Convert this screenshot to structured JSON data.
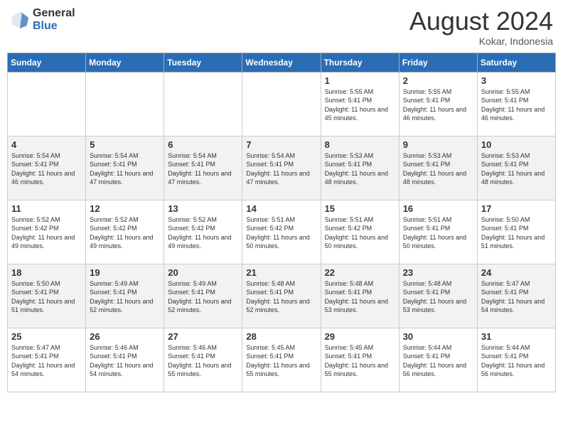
{
  "header": {
    "logo_general": "General",
    "logo_blue": "Blue",
    "month_year": "August 2024",
    "location": "Kokar, Indonesia"
  },
  "days_of_week": [
    "Sunday",
    "Monday",
    "Tuesday",
    "Wednesday",
    "Thursday",
    "Friday",
    "Saturday"
  ],
  "weeks": [
    [
      {
        "day": "",
        "sunrise": "",
        "sunset": "",
        "daylight": ""
      },
      {
        "day": "",
        "sunrise": "",
        "sunset": "",
        "daylight": ""
      },
      {
        "day": "",
        "sunrise": "",
        "sunset": "",
        "daylight": ""
      },
      {
        "day": "",
        "sunrise": "",
        "sunset": "",
        "daylight": ""
      },
      {
        "day": "1",
        "sunrise": "Sunrise: 5:55 AM",
        "sunset": "Sunset: 5:41 PM",
        "daylight": "Daylight: 11 hours and 45 minutes."
      },
      {
        "day": "2",
        "sunrise": "Sunrise: 5:55 AM",
        "sunset": "Sunset: 5:41 PM",
        "daylight": "Daylight: 11 hours and 46 minutes."
      },
      {
        "day": "3",
        "sunrise": "Sunrise: 5:55 AM",
        "sunset": "Sunset: 5:41 PM",
        "daylight": "Daylight: 11 hours and 46 minutes."
      }
    ],
    [
      {
        "day": "4",
        "sunrise": "Sunrise: 5:54 AM",
        "sunset": "Sunset: 5:41 PM",
        "daylight": "Daylight: 11 hours and 46 minutes."
      },
      {
        "day": "5",
        "sunrise": "Sunrise: 5:54 AM",
        "sunset": "Sunset: 5:41 PM",
        "daylight": "Daylight: 11 hours and 47 minutes."
      },
      {
        "day": "6",
        "sunrise": "Sunrise: 5:54 AM",
        "sunset": "Sunset: 5:41 PM",
        "daylight": "Daylight: 11 hours and 47 minutes."
      },
      {
        "day": "7",
        "sunrise": "Sunrise: 5:54 AM",
        "sunset": "Sunset: 5:41 PM",
        "daylight": "Daylight: 11 hours and 47 minutes."
      },
      {
        "day": "8",
        "sunrise": "Sunrise: 5:53 AM",
        "sunset": "Sunset: 5:41 PM",
        "daylight": "Daylight: 11 hours and 48 minutes."
      },
      {
        "day": "9",
        "sunrise": "Sunrise: 5:53 AM",
        "sunset": "Sunset: 5:41 PM",
        "daylight": "Daylight: 11 hours and 48 minutes."
      },
      {
        "day": "10",
        "sunrise": "Sunrise: 5:53 AM",
        "sunset": "Sunset: 5:41 PM",
        "daylight": "Daylight: 11 hours and 48 minutes."
      }
    ],
    [
      {
        "day": "11",
        "sunrise": "Sunrise: 5:52 AM",
        "sunset": "Sunset: 5:42 PM",
        "daylight": "Daylight: 11 hours and 49 minutes."
      },
      {
        "day": "12",
        "sunrise": "Sunrise: 5:52 AM",
        "sunset": "Sunset: 5:42 PM",
        "daylight": "Daylight: 11 hours and 49 minutes."
      },
      {
        "day": "13",
        "sunrise": "Sunrise: 5:52 AM",
        "sunset": "Sunset: 5:42 PM",
        "daylight": "Daylight: 11 hours and 49 minutes."
      },
      {
        "day": "14",
        "sunrise": "Sunrise: 5:51 AM",
        "sunset": "Sunset: 5:42 PM",
        "daylight": "Daylight: 11 hours and 50 minutes."
      },
      {
        "day": "15",
        "sunrise": "Sunrise: 5:51 AM",
        "sunset": "Sunset: 5:42 PM",
        "daylight": "Daylight: 11 hours and 50 minutes."
      },
      {
        "day": "16",
        "sunrise": "Sunrise: 5:51 AM",
        "sunset": "Sunset: 5:41 PM",
        "daylight": "Daylight: 11 hours and 50 minutes."
      },
      {
        "day": "17",
        "sunrise": "Sunrise: 5:50 AM",
        "sunset": "Sunset: 5:41 PM",
        "daylight": "Daylight: 11 hours and 51 minutes."
      }
    ],
    [
      {
        "day": "18",
        "sunrise": "Sunrise: 5:50 AM",
        "sunset": "Sunset: 5:41 PM",
        "daylight": "Daylight: 11 hours and 51 minutes."
      },
      {
        "day": "19",
        "sunrise": "Sunrise: 5:49 AM",
        "sunset": "Sunset: 5:41 PM",
        "daylight": "Daylight: 11 hours and 52 minutes."
      },
      {
        "day": "20",
        "sunrise": "Sunrise: 5:49 AM",
        "sunset": "Sunset: 5:41 PM",
        "daylight": "Daylight: 11 hours and 52 minutes."
      },
      {
        "day": "21",
        "sunrise": "Sunrise: 5:48 AM",
        "sunset": "Sunset: 5:41 PM",
        "daylight": "Daylight: 11 hours and 52 minutes."
      },
      {
        "day": "22",
        "sunrise": "Sunrise: 5:48 AM",
        "sunset": "Sunset: 5:41 PM",
        "daylight": "Daylight: 11 hours and 53 minutes."
      },
      {
        "day": "23",
        "sunrise": "Sunrise: 5:48 AM",
        "sunset": "Sunset: 5:41 PM",
        "daylight": "Daylight: 11 hours and 53 minutes."
      },
      {
        "day": "24",
        "sunrise": "Sunrise: 5:47 AM",
        "sunset": "Sunset: 5:41 PM",
        "daylight": "Daylight: 11 hours and 54 minutes."
      }
    ],
    [
      {
        "day": "25",
        "sunrise": "Sunrise: 5:47 AM",
        "sunset": "Sunset: 5:41 PM",
        "daylight": "Daylight: 11 hours and 54 minutes."
      },
      {
        "day": "26",
        "sunrise": "Sunrise: 5:46 AM",
        "sunset": "Sunset: 5:41 PM",
        "daylight": "Daylight: 11 hours and 54 minutes."
      },
      {
        "day": "27",
        "sunrise": "Sunrise: 5:46 AM",
        "sunset": "Sunset: 5:41 PM",
        "daylight": "Daylight: 11 hours and 55 minutes."
      },
      {
        "day": "28",
        "sunrise": "Sunrise: 5:45 AM",
        "sunset": "Sunset: 5:41 PM",
        "daylight": "Daylight: 11 hours and 55 minutes."
      },
      {
        "day": "29",
        "sunrise": "Sunrise: 5:45 AM",
        "sunset": "Sunset: 5:41 PM",
        "daylight": "Daylight: 11 hours and 55 minutes."
      },
      {
        "day": "30",
        "sunrise": "Sunrise: 5:44 AM",
        "sunset": "Sunset: 5:41 PM",
        "daylight": "Daylight: 11 hours and 56 minutes."
      },
      {
        "day": "31",
        "sunrise": "Sunrise: 5:44 AM",
        "sunset": "Sunset: 5:41 PM",
        "daylight": "Daylight: 11 hours and 56 minutes."
      }
    ]
  ]
}
